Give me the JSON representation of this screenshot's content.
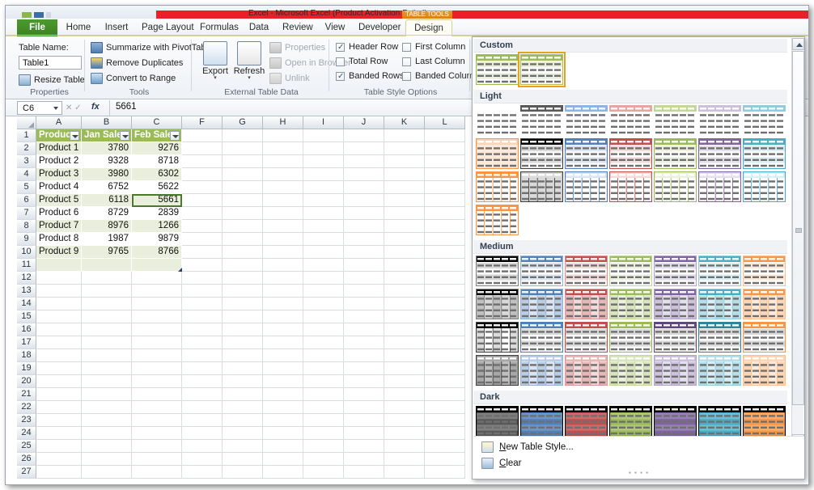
{
  "window": {
    "title": "Excel - Microsoft Excel (Product Activation Failed)",
    "contextual_tab_group": "TABLE TOOLS"
  },
  "tabs": [
    {
      "label": "File",
      "active": false,
      "file": true
    },
    {
      "label": "Home",
      "active": false
    },
    {
      "label": "Insert",
      "active": false
    },
    {
      "label": "Page Layout",
      "active": false
    },
    {
      "label": "Formulas",
      "active": false
    },
    {
      "label": "Data",
      "active": false
    },
    {
      "label": "Review",
      "active": false
    },
    {
      "label": "View",
      "active": false
    },
    {
      "label": "Developer",
      "active": false
    },
    {
      "label": "Design",
      "active": true
    }
  ],
  "ribbon": {
    "properties_group": {
      "label": "Properties",
      "table_name_label": "Table Name:",
      "table_name_value": "Table1",
      "resize_table": "Resize Table"
    },
    "tools_group": {
      "label": "Tools",
      "items": [
        {
          "label": "Summarize with PivotTable",
          "disabled": false
        },
        {
          "label": "Remove Duplicates",
          "disabled": false
        },
        {
          "label": "Convert to Range",
          "disabled": false
        }
      ]
    },
    "external_group": {
      "label": "External Table Data",
      "export": "Export",
      "refresh": "Refresh",
      "items": [
        {
          "label": "Properties",
          "disabled": true
        },
        {
          "label": "Open in Browser",
          "disabled": true
        },
        {
          "label": "Unlink",
          "disabled": true
        }
      ]
    },
    "style_options_group": {
      "label": "Table Style Options",
      "options": [
        {
          "label": "Header Row",
          "checked": true
        },
        {
          "label": "First Column",
          "checked": false
        },
        {
          "label": "Total Row",
          "checked": false
        },
        {
          "label": "Last Column",
          "checked": false
        },
        {
          "label": "Banded Rows",
          "checked": true
        },
        {
          "label": "Banded Columns",
          "checked": false
        }
      ]
    }
  },
  "formula_bar": {
    "name_box": "C6",
    "formula": "5661"
  },
  "sheet": {
    "columns": [
      "A",
      "B",
      "C",
      "F",
      "G",
      "H",
      "I",
      "J",
      "K",
      "L"
    ],
    "rows": [
      1,
      2,
      3,
      4,
      5,
      6,
      7,
      8,
      9,
      10,
      11,
      12,
      13,
      14,
      15,
      16,
      17,
      18,
      19,
      20,
      21,
      22,
      23,
      24,
      25,
      26,
      27
    ],
    "table": {
      "headers": [
        "Product",
        "Jan Sales",
        "Feb Sales"
      ],
      "data": [
        [
          "Product 1",
          "3780",
          "9276"
        ],
        [
          "Product 2",
          "9328",
          "8718"
        ],
        [
          "Product 3",
          "3980",
          "6302"
        ],
        [
          "Product 4",
          "6752",
          "5622"
        ],
        [
          "Product 5",
          "6118",
          "5661"
        ],
        [
          "Product 6",
          "8729",
          "2839"
        ],
        [
          "Product 7",
          "8976",
          "1266"
        ],
        [
          "Product 8",
          "1987",
          "9879"
        ],
        [
          "Product 9",
          "9765",
          "8766"
        ]
      ]
    },
    "selected_cell": "C6",
    "colors": {
      "header_fill": "#9bbb59",
      "band_fill": "#e9efdc",
      "selection_border": "#4a7a2a"
    }
  },
  "gallery": {
    "sections": [
      {
        "name": "Custom",
        "rows": [
          [
            {
              "header": "#9bbb59",
              "body": "#ffffff",
              "stripe": "#e9efdc",
              "border": "#9bbb59",
              "mode": "rows",
              "selected": false
            },
            {
              "header": "#9bbb59",
              "body": "#ffffff",
              "stripe": "#e9efdc",
              "border": "#c8b45a",
              "mode": "rows",
              "selected": true
            }
          ]
        ]
      },
      {
        "name": "Light",
        "rows": [
          [
            {
              "header": "#ffffff",
              "body": "#ffffff",
              "stripe": "#ffffff",
              "border": "none",
              "mode": "plain"
            },
            {
              "header": "#595959",
              "body": "#ffffff",
              "stripe": "#e8e8e8",
              "border": "none",
              "mode": "plain"
            },
            {
              "header": "#8eb4e3",
              "body": "#ffffff",
              "stripe": "#eaf1fa",
              "border": "none",
              "mode": "plain"
            },
            {
              "header": "#e6a6a0",
              "body": "#ffffff",
              "stripe": "#fbeceb",
              "border": "none",
              "mode": "plain"
            },
            {
              "header": "#c3d69b",
              "body": "#ffffff",
              "stripe": "#eff4e4",
              "border": "none",
              "mode": "plain"
            },
            {
              "header": "#ccc0da",
              "body": "#ffffff",
              "stripe": "#f1eef6",
              "border": "none",
              "mode": "plain"
            },
            {
              "header": "#93cddd",
              "body": "#ffffff",
              "stripe": "#e7f4f8",
              "border": "none",
              "mode": "plain"
            }
          ],
          [
            {
              "header": "#fcd5b5",
              "body": "#fde9d9",
              "stripe": "#fde9d9",
              "border": "#f79646",
              "mode": "rows"
            },
            {
              "header": "#000000",
              "body": "#ffffff",
              "stripe": "#d9d9d9",
              "border": "#404040",
              "mode": "rows"
            },
            {
              "header": "#4f81bd",
              "body": "#ffffff",
              "stripe": "#dbe5f1",
              "border": "#4f81bd",
              "mode": "rows"
            },
            {
              "header": "#c0504d",
              "body": "#ffffff",
              "stripe": "#f2dcdb",
              "border": "#c0504d",
              "mode": "rows"
            },
            {
              "header": "#9bbb59",
              "body": "#ffffff",
              "stripe": "#ebf1de",
              "border": "#9bbb59",
              "mode": "rows"
            },
            {
              "header": "#8064a2",
              "body": "#ffffff",
              "stripe": "#e4dfec",
              "border": "#8064a2",
              "mode": "rows"
            },
            {
              "header": "#4bacc6",
              "body": "#ffffff",
              "stripe": "#daeef3",
              "border": "#4bacc6",
              "mode": "rows"
            }
          ],
          [
            {
              "header": "#f79646",
              "body": "#ffffff",
              "stripe": "#ffffff",
              "border": "#f79646",
              "mode": "cols"
            },
            {
              "header": "#d9d9d9",
              "body": "#d9d9d9",
              "stripe": "#d9d9d9",
              "border": "#404040",
              "mode": "cols"
            },
            {
              "header": "#dbe5f1",
              "body": "#ffffff",
              "stripe": "#ffffff",
              "border": "#4f81bd",
              "mode": "cols"
            },
            {
              "header": "#f2dcdb",
              "body": "#ffffff",
              "stripe": "#ffffff",
              "border": "#c0504d",
              "mode": "cols"
            },
            {
              "header": "#ebf1de",
              "body": "#ffffff",
              "stripe": "#ffffff",
              "border": "#9bbb59",
              "mode": "cols"
            },
            {
              "header": "#e4dfec",
              "body": "#ffffff",
              "stripe": "#ffffff",
              "border": "#8064a2",
              "mode": "cols"
            },
            {
              "header": "#daeef3",
              "body": "#ffffff",
              "stripe": "#ffffff",
              "border": "#4bacc6",
              "mode": "cols"
            }
          ],
          [
            {
              "header": "#f79646",
              "body": "#ffffff",
              "stripe": "#ffffff",
              "border": "#f79646",
              "mode": "cols"
            }
          ]
        ]
      },
      {
        "name": "Medium",
        "rows": [
          [
            {
              "header": "#000000",
              "body": "#ffffff",
              "stripe": "#d9d9d9",
              "border": "#7f7f7f",
              "mode": "rows"
            },
            {
              "header": "#4f81bd",
              "body": "#ffffff",
              "stripe": "#dbe5f1",
              "border": "#95b3d7",
              "mode": "rows"
            },
            {
              "header": "#c0504d",
              "body": "#ffffff",
              "stripe": "#f2dcdb",
              "border": "#da9694",
              "mode": "rows"
            },
            {
              "header": "#9bbb59",
              "body": "#ffffff",
              "stripe": "#ebf1de",
              "border": "#c3d69b",
              "mode": "rows"
            },
            {
              "header": "#8064a2",
              "body": "#ffffff",
              "stripe": "#e4dfec",
              "border": "#b2a2c7",
              "mode": "rows"
            },
            {
              "header": "#4bacc6",
              "body": "#ffffff",
              "stripe": "#daeef3",
              "border": "#92cddc",
              "mode": "rows"
            },
            {
              "header": "#f79646",
              "body": "#ffffff",
              "stripe": "#fde9d9",
              "border": "#fac090",
              "mode": "rows"
            }
          ],
          [
            {
              "header": "#000000",
              "body": "#d9d9d9",
              "stripe": "#bfbfbf",
              "border": "#7f7f7f",
              "mode": "cols"
            },
            {
              "header": "#4f81bd",
              "body": "#dbe5f1",
              "stripe": "#b8cce4",
              "border": "#95b3d7",
              "mode": "cols"
            },
            {
              "header": "#c0504d",
              "body": "#f2dcdb",
              "stripe": "#e5b8b7",
              "border": "#da9694",
              "mode": "cols"
            },
            {
              "header": "#9bbb59",
              "body": "#ebf1de",
              "stripe": "#d7e4bd",
              "border": "#c3d69b",
              "mode": "cols"
            },
            {
              "header": "#8064a2",
              "body": "#e4dfec",
              "stripe": "#ccc0da",
              "border": "#b2a2c7",
              "mode": "cols"
            },
            {
              "header": "#4bacc6",
              "body": "#daeef3",
              "stripe": "#b7dee8",
              "border": "#92cddc",
              "mode": "cols"
            },
            {
              "header": "#f79646",
              "body": "#fde9d9",
              "stripe": "#fcd5b5",
              "border": "#fac090",
              "mode": "cols"
            }
          ],
          [
            {
              "header": "#000000",
              "body": "#ffffff",
              "stripe": "#d9d9d9",
              "border": "#404040",
              "mode": "cols"
            },
            {
              "header": "#4f81bd",
              "body": "#ffffff",
              "stripe": "#d9d9d9",
              "border": "#4f81bd",
              "mode": "rows"
            },
            {
              "header": "#c0504d",
              "body": "#ffffff",
              "stripe": "#d9d9d9",
              "border": "#c0504d",
              "mode": "rows"
            },
            {
              "header": "#9bbb59",
              "body": "#ffffff",
              "stripe": "#d9d9d9",
              "border": "#9bbb59",
              "mode": "rows"
            },
            {
              "header": "#60497a",
              "body": "#ffffff",
              "stripe": "#d9d9d9",
              "border": "#60497a",
              "mode": "rows"
            },
            {
              "header": "#31859b",
              "body": "#ffffff",
              "stripe": "#d9d9d9",
              "border": "#31859b",
              "mode": "rows"
            },
            {
              "header": "#f79646",
              "body": "#ffffff",
              "stripe": "#d9d9d9",
              "border": "#f79646",
              "mode": "rows"
            }
          ],
          [
            {
              "header": "#a6a6a6",
              "body": "#bfbfbf",
              "stripe": "#a6a6a6",
              "border": "#404040",
              "mode": "cols"
            },
            {
              "header": "#b8cce4",
              "body": "#dbe5f1",
              "stripe": "#b8cce4",
              "border": "#95b3d7",
              "mode": "cols"
            },
            {
              "header": "#e5b8b7",
              "body": "#f2dcdb",
              "stripe": "#e5b8b7",
              "border": "#da9694",
              "mode": "cols"
            },
            {
              "header": "#d7e4bd",
              "body": "#ebf1de",
              "stripe": "#d7e4bd",
              "border": "#c3d69b",
              "mode": "cols"
            },
            {
              "header": "#ccc0da",
              "body": "#e4dfec",
              "stripe": "#ccc0da",
              "border": "#b2a2c7",
              "mode": "cols"
            },
            {
              "header": "#b7dee8",
              "body": "#daeef3",
              "stripe": "#b7dee8",
              "border": "#92cddc",
              "mode": "cols"
            },
            {
              "header": "#fcd5b5",
              "body": "#fde9d9",
              "stripe": "#fcd5b5",
              "border": "#fac090",
              "mode": "cols"
            }
          ]
        ]
      },
      {
        "name": "Dark",
        "rows": [
          [
            {
              "header": "#000000",
              "body": "#595959",
              "stripe": "#7f7f7f",
              "border": "#000000",
              "mode": "rows"
            },
            {
              "header": "#000000",
              "body": "#4f81bd",
              "stripe": "#6d96c6",
              "border": "#000000",
              "mode": "rows"
            },
            {
              "header": "#000000",
              "body": "#c0504d",
              "stripe": "#cc6c6a",
              "border": "#000000",
              "mode": "rows"
            },
            {
              "header": "#000000",
              "body": "#9bbb59",
              "stripe": "#aec77a",
              "border": "#000000",
              "mode": "rows"
            },
            {
              "header": "#000000",
              "body": "#8064a2",
              "stripe": "#9881b5",
              "border": "#000000",
              "mode": "rows"
            },
            {
              "header": "#000000",
              "body": "#4bacc6",
              "stripe": "#6fbed3",
              "border": "#000000",
              "mode": "rows"
            },
            {
              "header": "#000000",
              "body": "#f79646",
              "stripe": "#f9ac6b",
              "border": "#000000",
              "mode": "rows"
            }
          ]
        ]
      }
    ],
    "footer": {
      "new_table_style": "New Table Style...",
      "clear": "Clear"
    }
  }
}
